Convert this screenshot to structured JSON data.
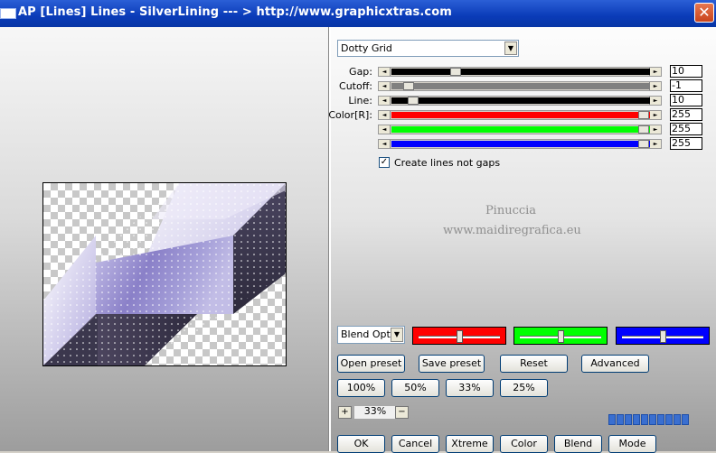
{
  "window": {
    "title": "AP [Lines]  Lines - SilverLining      --- > http://www.graphicxtras.com"
  },
  "preset": {
    "selected": "Dotty Grid"
  },
  "sliders": [
    {
      "label": "Gap:",
      "value": "10",
      "fraction": 0.24,
      "fill_color": "#000000"
    },
    {
      "label": "Cutoff:",
      "value": "-1",
      "fraction": 0.05,
      "fill_color": "#808080"
    },
    {
      "label": "Line:",
      "value": "10",
      "fraction": 0.07,
      "fill_color": "#000000"
    },
    {
      "label": "Color[R]:",
      "value": "255",
      "fraction": 1.0,
      "fill_color": "#ff0000"
    },
    {
      "label": "",
      "value": "255",
      "fraction": 1.0,
      "fill_color": "#00ff00"
    },
    {
      "label": "",
      "value": "255",
      "fraction": 1.0,
      "fill_color": "#0000ff"
    }
  ],
  "checkbox": {
    "label": "Create lines not gaps",
    "checked": true
  },
  "watermark": {
    "line1": "Pinuccia",
    "line2": "www.maidiregrafica.eu"
  },
  "blend": {
    "selected": "Blend Optio"
  },
  "color_boxes": [
    {
      "color": "#ff0000",
      "level": 0.5
    },
    {
      "color": "#00ff00",
      "level": 0.5
    },
    {
      "color": "#0000ff",
      "level": 0.5
    }
  ],
  "buttons": {
    "open_preset": "Open preset",
    "save_preset": "Save preset",
    "reset": "Reset",
    "advanced": "Advanced",
    "zoom_100": "100%",
    "zoom_50": "50%",
    "zoom_33": "33%",
    "zoom_25": "25%",
    "ok": "OK",
    "cancel": "Cancel",
    "xtreme": "Xtreme",
    "color": "Color",
    "blend": "Blend",
    "mode": "Mode"
  },
  "zoom": {
    "value": "33%",
    "plus": "+",
    "minus": "−"
  },
  "icons": {
    "close": "close-icon",
    "check": "check-icon",
    "dropdown": "chevron-down-icon"
  },
  "colors": {
    "titlebar": "#0a3bb8",
    "preview_shape": "#8a80c8"
  }
}
